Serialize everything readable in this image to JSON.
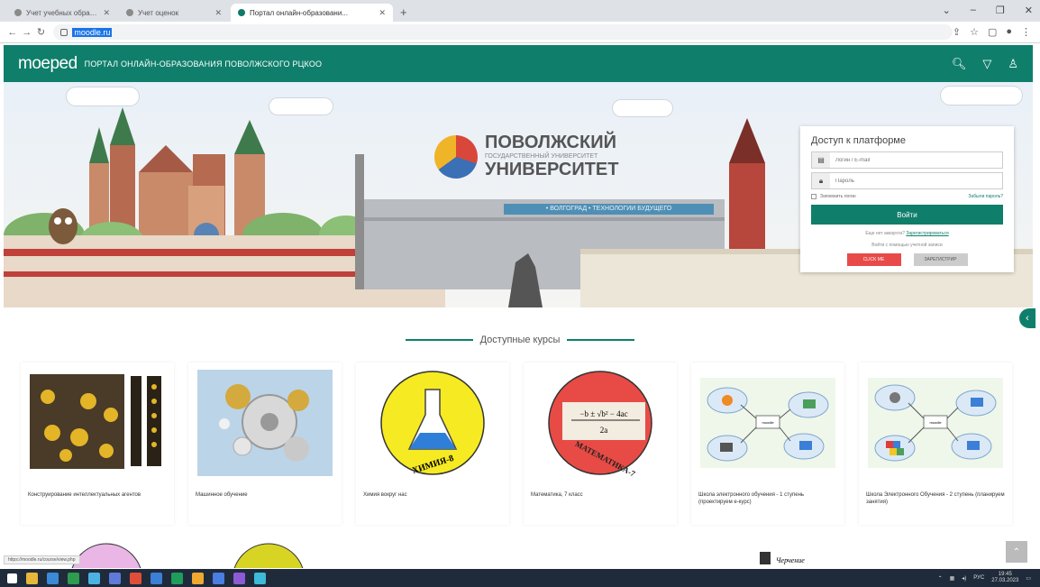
{
  "browser": {
    "tabs": [
      {
        "title": "Учет учебных образоват...",
        "active": false
      },
      {
        "title": "Учет оценок",
        "active": false
      },
      {
        "title": "Портал онлайн-образовани...",
        "active": true
      }
    ],
    "new_tab": "+",
    "url": "moodle.ru"
  },
  "header": {
    "logo": "moeped",
    "title": "ПОРТАЛ ОНЛАЙН-ОБРАЗОВАНИЯ ПОВОЛЖСКОГО РЦКОО"
  },
  "banner": {
    "uni_line1": "ПОВОЛЖСКИЙ",
    "uni_line2": "ГОСУДАРСТВЕННЫЙ УНИВЕРСИТЕТ",
    "uni_line3": "УНИВЕРСИТЕТ",
    "strip": "• ВОЛГОГРАД • ТЕХНОЛОГИИ БУДУЩЕГО"
  },
  "login": {
    "title": "Доступ к платформе",
    "login_placeholder": "Логин / E-mail",
    "password_placeholder": "Пароль",
    "remember": "Запомнить логин",
    "forgot": "Забыли пароль?",
    "submit": "Войти",
    "no_account": "Еще нет аккаунта?",
    "register": "Зарегистрироваться",
    "login_with": "Войти с помощью учетной записи",
    "btn_red": "CLICK ME",
    "btn_grey": "ЗАРЕГИСТРИР"
  },
  "courses": {
    "title": "Доступные курсы",
    "items": [
      {
        "name": "Конструирование интеллектуальных агентов"
      },
      {
        "name": "Машинное обучение"
      },
      {
        "name": "Химия вокруг нас"
      },
      {
        "name": "Математика, 7 класс"
      },
      {
        "name": "Школа электронного обучения - 1 ступень (проектируем е-курс)"
      },
      {
        "name": "Школа Электронного Обучения - 2 ступень (планируем занятия)"
      }
    ]
  },
  "course_images": {
    "chem_label": "ХИМИЯ-8",
    "math_label": "МАТЕМАТИКА-7",
    "math_formula": "−b ± √b² − 4ac",
    "math_denominator": "2a",
    "node_label": "moodle"
  },
  "status_url": "https://moodle.ru/course/view.php",
  "bottom_card_label": "Черчение",
  "tray": {
    "lang": "РУС",
    "time": "19:45",
    "date": "27.03.2023"
  },
  "colors": {
    "accent": "#0f7f6b",
    "red": "#e84a4a"
  }
}
